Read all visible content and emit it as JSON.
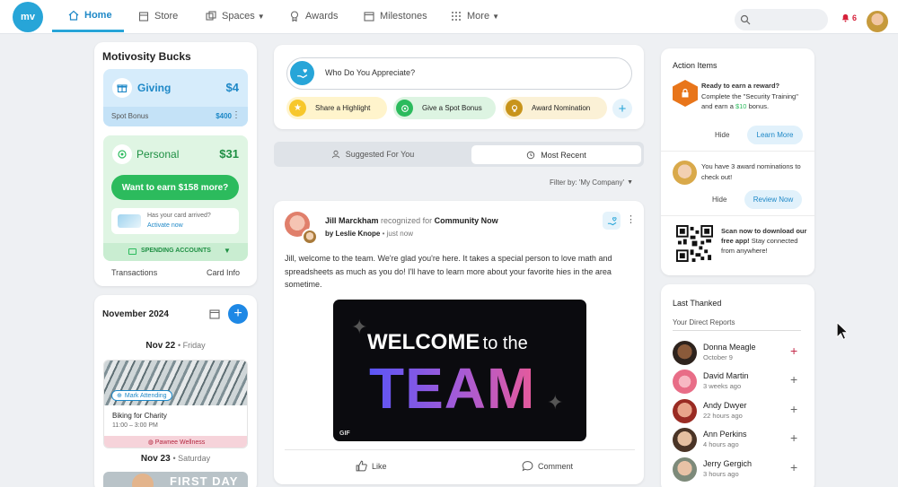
{
  "logo": "mv",
  "nav": {
    "home": "Home",
    "store": "Store",
    "spaces": "Spaces",
    "awards": "Awards",
    "milestones": "Milestones",
    "more": "More"
  },
  "notifications": {
    "count": "6"
  },
  "bucks": {
    "title": "Motivosity Bucks",
    "giving_label": "Giving",
    "giving_amount": "$4",
    "spot_bonus_label": "Spot Bonus",
    "spot_bonus_amount": "$400",
    "personal_label": "Personal",
    "personal_amount": "$31",
    "earn_button": "Want to earn $158 more?",
    "card_question": "Has your card arrived?",
    "activate": "Activate now",
    "spending_accounts": "SPENDING ACCOUNTS",
    "transactions": "Transactions",
    "card_info": "Card Info"
  },
  "calendar": {
    "month": "November 2024",
    "date1": "Nov 22",
    "day1": "Friday",
    "mark_attending": "Mark Attending",
    "event_title": "Biking for Charity",
    "event_time": "11:00 – 3:00 PM",
    "event_org": "Pawnee Wellness",
    "date2": "Nov 23",
    "day2": "Saturday",
    "next_banner": "FIRST DAY"
  },
  "composer": {
    "placeholder": "Who Do You Appreciate?",
    "share_highlight": "Share a Highlight",
    "spot_bonus": "Give a Spot Bonus",
    "award_nomination": "Award Nomination"
  },
  "feed_tabs": {
    "suggested": "Suggested For You",
    "recent": "Most Recent"
  },
  "filter": "Filter by: 'My Company'",
  "post": {
    "author": "Jill Marckham",
    "recognized_for": "recognized for",
    "value": "Community Now",
    "by": "by Leslie Knope",
    "time": "just now",
    "body": "Jill, welcome to the team. We're glad you're here. It takes a special person to love math and spreadsheets as much as you do! I'll have to learn more about your favorite hies in the area sometime.",
    "gif_line1a": "WELCOME",
    "gif_line1b": "to the",
    "gif_line2": "TEAM",
    "gif_tag": "GIF",
    "like": "Like",
    "comment": "Comment"
  },
  "actions": {
    "title": "Action Items",
    "item1_bold": "Ready to earn a reward?",
    "item1_text_a": "Complete the \"Security Training\" and earn a",
    "item1_amount": "$10",
    "item1_text_b": "bonus.",
    "hide": "Hide",
    "learn_more": "Learn More",
    "item2_text": "You have 3 award nominations to check out!",
    "review_now": "Review Now",
    "qr_bold": "Scan now to download our free app!",
    "qr_text": "Stay connected from anywhere!"
  },
  "thanked": {
    "title": "Last Thanked",
    "subtitle": "Your Direct Reports",
    "people": [
      {
        "name": "Donna Meagle",
        "when": "October 9"
      },
      {
        "name": "David Martin",
        "when": "3 weeks ago"
      },
      {
        "name": "Andy Dwyer",
        "when": "22 hours ago"
      },
      {
        "name": "Ann Perkins",
        "when": "4 hours ago"
      },
      {
        "name": "Jerry Gergich",
        "when": "3 hours ago"
      }
    ]
  },
  "colors": {
    "accent": "#27a5d8",
    "giving_bg": "#d6ecfb",
    "personal_bg": "#dff5e3",
    "green": "#2cbb5d"
  }
}
